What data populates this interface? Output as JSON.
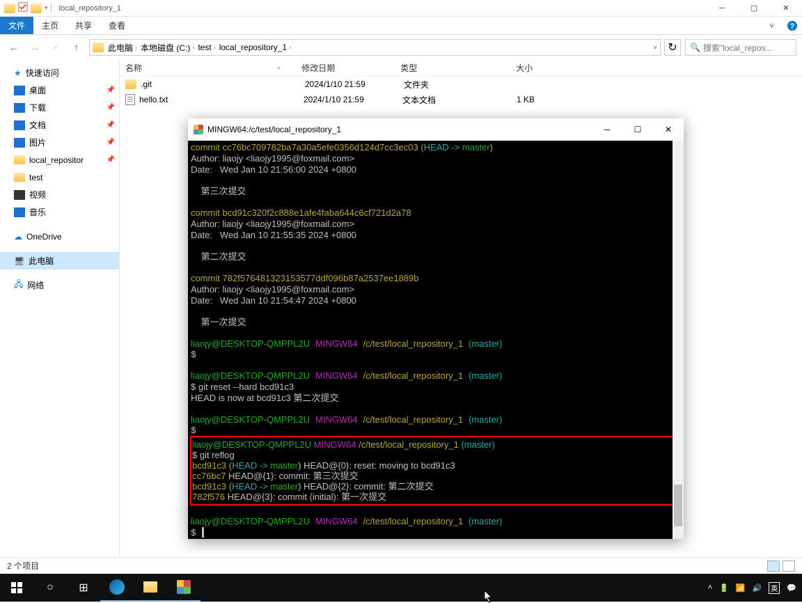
{
  "title_bar": {
    "caption": "local_repository_1"
  },
  "ribbon": {
    "file": "文件",
    "tabs": [
      "主页",
      "共享",
      "查看"
    ],
    "expand": "˅"
  },
  "nav": {
    "crumbs": [
      "此电脑",
      "本地磁盘 (C:)",
      "test",
      "local_repository_1"
    ],
    "search_placeholder": "搜索\"local_repos..."
  },
  "sidebar": {
    "quick": "快速访问",
    "items": [
      {
        "label": "桌面",
        "pin": true,
        "ico": "desktop"
      },
      {
        "label": "下载",
        "pin": true,
        "ico": "down"
      },
      {
        "label": "文档",
        "pin": true,
        "ico": "doc"
      },
      {
        "label": "图片",
        "pin": true,
        "ico": "pic"
      },
      {
        "label": "local_repositor",
        "pin": true,
        "ico": "fold"
      },
      {
        "label": "test",
        "pin": false,
        "ico": "fold"
      },
      {
        "label": "视频",
        "pin": false,
        "ico": "vid"
      },
      {
        "label": "音乐",
        "pin": false,
        "ico": "music"
      }
    ],
    "onedrive": "OneDrive",
    "thispc": "此电脑",
    "network": "网络"
  },
  "columns": {
    "name": "名称",
    "date": "修改日期",
    "type": "类型",
    "size": "大小"
  },
  "files": [
    {
      "name": ".git",
      "date": "2024/1/10 21:59",
      "type": "文件夹",
      "size": "",
      "kind": "folder"
    },
    {
      "name": "hello.txt",
      "date": "2024/1/10 21:59",
      "type": "文本文档",
      "size": "1 KB",
      "kind": "txt"
    }
  ],
  "status": "2 个项目",
  "terminal": {
    "title": "MINGW64:/c/test/local_repository_1",
    "commit1": {
      "hash": "cc76bc709782ba7a30a5efe0356d124d7cc3ec03",
      "head": "HEAD -> ",
      "branch": "master",
      "author": "Author: liaojy <liaojy1995@foxmail.com>",
      "date": "Date:   Wed Jan 10 21:56:00 2024 +0800",
      "msg": "    第三次提交"
    },
    "commit2": {
      "hash": "bcd91c320f2c888e1afe4faba644c6cf721d2a78",
      "author": "Author: liaojy <liaojy1995@foxmail.com>",
      "date": "Date:   Wed Jan 10 21:55:35 2024 +0800",
      "msg": "    第二次提交"
    },
    "commit3": {
      "hash": "782f576481323153577ddf096b87a2537ee1889b",
      "author": "Author: liaojy <liaojy1995@foxmail.com>",
      "date": "Date:   Wed Jan 10 21:54:47 2024 +0800",
      "msg": "    第一次提交"
    },
    "prompt_user": "liaojy@DESKTOP-QMPPL2U",
    "prompt_sys": "MINGW64",
    "prompt_path": "/c/test/local_repository_1",
    "prompt_branch": "(master)",
    "cmd_reset": "$ git reset --hard bcd91c3",
    "reset_out": "HEAD is now at bcd91c3 第二次提交",
    "cmd_reflog": "$ git reflog",
    "reflog": [
      {
        "sha": "bcd91c3",
        "head": " (",
        "h2": "HEAD -> ",
        "br": "master",
        "rest": ") HEAD@{0}: reset: moving to bcd91c3"
      },
      {
        "sha": "cc76bc7",
        "rest": " HEAD@{1}: commit: 第三次提交"
      },
      {
        "sha": "bcd91c3",
        "head": " (",
        "h2": "HEAD -> ",
        "br": "master",
        "rest": ") HEAD@{2}: commit: 第二次提交"
      },
      {
        "sha": "782f576",
        "rest": " HEAD@{3}: commit (initial): 第一次提交"
      }
    ]
  },
  "taskbar": {
    "time": "",
    "ime": "英"
  }
}
